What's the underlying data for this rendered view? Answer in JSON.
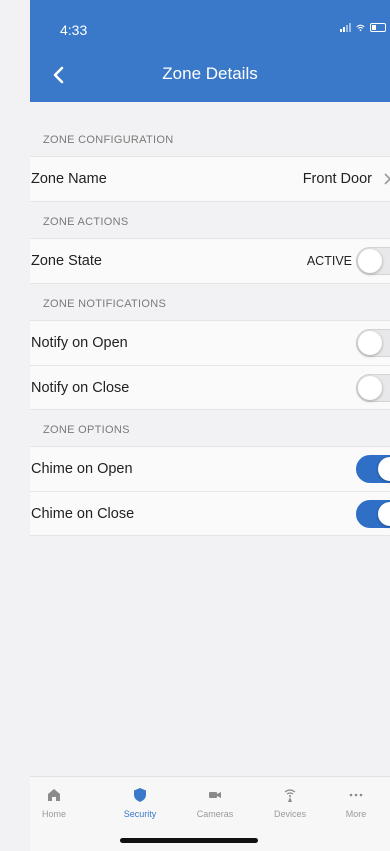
{
  "status_bar": {
    "time": "4:33"
  },
  "header": {
    "title": "Zone Details",
    "back_icon": "chevron-left-icon"
  },
  "sections": {
    "config": {
      "title": "ZONE CONFIGURATION",
      "zone_name_label": "Zone Name",
      "zone_name_value": "Front Door"
    },
    "actions": {
      "title": "ZONE ACTIONS",
      "zone_state_label": "Zone State",
      "zone_state_value": "ACTIVE",
      "zone_state_toggle_on": false
    },
    "notifications": {
      "title": "ZONE NOTIFICATIONS",
      "notify_open_label": "Notify on Open",
      "notify_open_on": false,
      "notify_close_label": "Notify on Close",
      "notify_close_on": false
    },
    "options": {
      "title": "ZONE OPTIONS",
      "chime_open_label": "Chime on Open",
      "chime_open_on": true,
      "chime_close_label": "Chime on Close",
      "chime_close_on": true
    }
  },
  "tabbar": {
    "tabs": [
      {
        "label": "Home",
        "icon": "home-icon",
        "active": false
      },
      {
        "label": "Security",
        "icon": "shield-icon",
        "active": true
      },
      {
        "label": "Cameras",
        "icon": "camera-icon",
        "active": false
      },
      {
        "label": "Devices",
        "icon": "wifi-device-icon",
        "active": false
      },
      {
        "label": "More",
        "icon": "more-icon",
        "active": false
      }
    ]
  },
  "colors": {
    "header_bg": "#3a78c9",
    "toggle_on": "#2f6fc6",
    "active_tab": "#3a78c9"
  }
}
